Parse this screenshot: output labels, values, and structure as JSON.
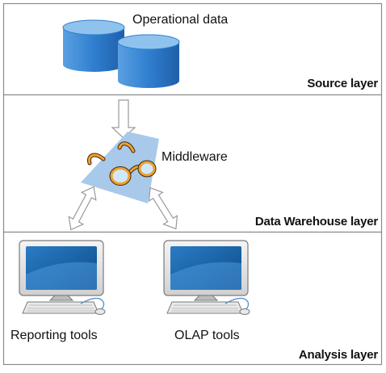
{
  "layers": {
    "source": {
      "name": "Source layer"
    },
    "warehouse": {
      "name": "Data Warehouse layer"
    },
    "analysis": {
      "name": "Analysis layer"
    }
  },
  "nodes": {
    "operational_data": {
      "label": "Operational data",
      "icon": "database-icon"
    },
    "middleware": {
      "label": "Middleware",
      "icon": "glasses-icon"
    },
    "reporting_tools": {
      "label": "Reporting tools",
      "icon": "computer-icon"
    },
    "olap_tools": {
      "label": "OLAP tools",
      "icon": "computer-icon"
    }
  },
  "colors": {
    "border": "#8a8a8a",
    "db_top": "#8fc3ee",
    "db_body": "#3a86d0",
    "middleware_shape": "#a9c9ea",
    "glasses": "#f0a030",
    "lens": "#cfe8fb",
    "arrow_fill": "#ffffff",
    "arrow_stroke": "#9a9a9a"
  }
}
